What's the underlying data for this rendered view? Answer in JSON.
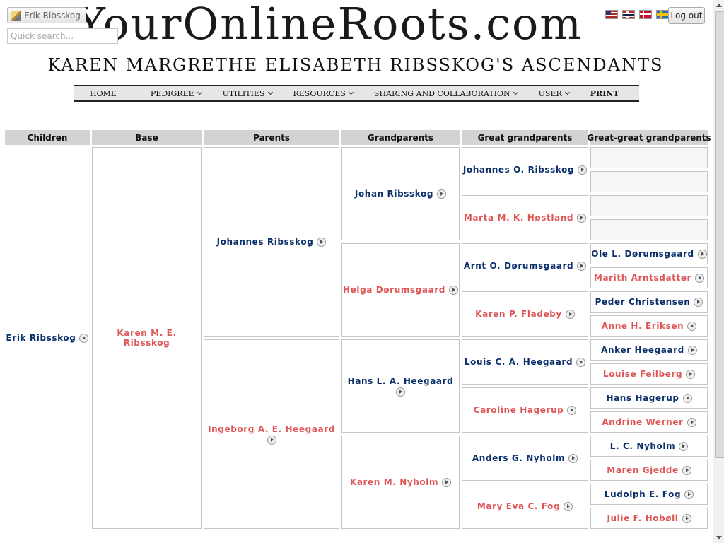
{
  "header": {
    "logo_text": "YourOnlineRoots.com",
    "user_button_label": "Erik Ribsskog",
    "search_placeholder": "Quick search...",
    "logout_label": "Log out",
    "page_title": "KAREN MARGRETHE ELISABETH RIBSSKOG'S ASCENDANTS"
  },
  "nav": {
    "items": [
      {
        "label": "HOME"
      },
      {
        "label": "PEDIGREE"
      },
      {
        "label": "UTILITIES"
      },
      {
        "label": "RESOURCES"
      },
      {
        "label": "SHARING AND COLLABORATION"
      },
      {
        "label": "USER"
      },
      {
        "label": "PRINT"
      }
    ]
  },
  "columns": [
    "Children",
    "Base",
    "Parents",
    "Grandparents",
    "Great grandparents",
    "Great-great grandparents"
  ],
  "tree": {
    "children": [
      {
        "name": "Erik Ribsskog",
        "gender": "male"
      }
    ],
    "base": [
      {
        "name": "Karen M. E. Ribsskog",
        "gender": "female"
      }
    ],
    "parents": [
      {
        "name": "Johannes Ribsskog",
        "gender": "male"
      },
      {
        "name": "Ingeborg A. E. Heegaard",
        "gender": "female"
      }
    ],
    "grandparents": [
      {
        "name": "Johan Ribsskog",
        "gender": "male"
      },
      {
        "name": "Helga Dørumsgaard",
        "gender": "female"
      },
      {
        "name": "Hans L. A. Heegaard",
        "gender": "male"
      },
      {
        "name": "Karen M. Nyholm",
        "gender": "female"
      }
    ],
    "great_grandparents": [
      {
        "name": "Johannes O. Ribsskog",
        "gender": "male"
      },
      {
        "name": "Marta M. K. Høstland",
        "gender": "female"
      },
      {
        "name": "Arnt O. Dørumsgaard",
        "gender": "male"
      },
      {
        "name": "Karen P. Fladeby",
        "gender": "female"
      },
      {
        "name": "Louis C. A. Heegaard",
        "gender": "male"
      },
      {
        "name": "Caroline Hagerup",
        "gender": "female"
      },
      {
        "name": "Anders G. Nyholm",
        "gender": "male"
      },
      {
        "name": "Mary Eva C. Fog",
        "gender": "female"
      }
    ],
    "great_great_grandparents": [
      {
        "name": "",
        "gender": "male"
      },
      {
        "name": "",
        "gender": "female"
      },
      {
        "name": "",
        "gender": "male"
      },
      {
        "name": "",
        "gender": "female"
      },
      {
        "name": "Ole L. Dørumsgaard",
        "gender": "male"
      },
      {
        "name": "Marith Arntsdatter",
        "gender": "female"
      },
      {
        "name": "Peder Christensen",
        "gender": "male"
      },
      {
        "name": "Anne H. Eriksen",
        "gender": "female"
      },
      {
        "name": "Anker Heegaard",
        "gender": "male"
      },
      {
        "name": "Louise Feilberg",
        "gender": "female"
      },
      {
        "name": "Hans Hagerup",
        "gender": "male"
      },
      {
        "name": "Andrine Werner",
        "gender": "female"
      },
      {
        "name": "L. C. Nyholm",
        "gender": "male"
      },
      {
        "name": "Maren Gjedde",
        "gender": "female"
      },
      {
        "name": "Ludolph E. Fog",
        "gender": "male"
      },
      {
        "name": "Julie F. Hobøll",
        "gender": "female"
      }
    ]
  }
}
